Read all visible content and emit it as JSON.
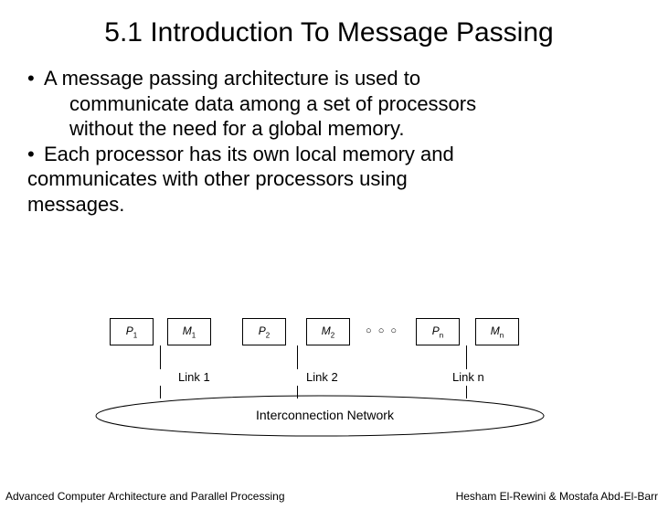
{
  "title": "5.1 Introduction To Message Passing",
  "bullets": {
    "b1_marker": "•",
    "b1_first": "A message passing architecture is used to",
    "b1_l2": "communicate data among a set of processors",
    "b1_l3": "without the need for a global memory.",
    "b2_marker": "•",
    "b2_first": "Each processor has its own local memory and",
    "b2_l2": "communicates with other processors using",
    "b2_l3": "messages."
  },
  "diagram": {
    "p1": "P",
    "p1_sub": "1",
    "m1": "M",
    "m1_sub": "1",
    "p2": "P",
    "p2_sub": "2",
    "m2": "M",
    "m2_sub": "2",
    "pn": "P",
    "pn_sub": "n",
    "mn": "M",
    "mn_sub": "n",
    "dots": "○ ○ ○",
    "link1": "Link 1",
    "link2": "Link 2",
    "linkn": "Link n",
    "network": "Interconnection Network"
  },
  "footer": {
    "left": "Advanced Computer Architecture and Parallel Processing",
    "right": "Hesham El-Rewini & Mostafa Abd-El-Barr"
  }
}
